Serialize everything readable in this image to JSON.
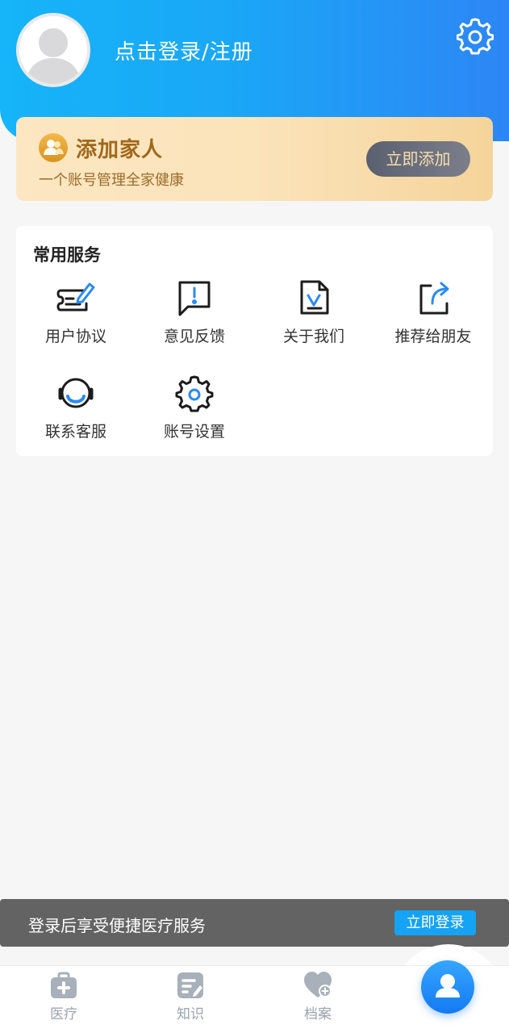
{
  "header": {
    "login_text": "点击登录/注册",
    "avatar_icon": "user-avatar-icon",
    "settings_icon": "gear-icon"
  },
  "family_card": {
    "title": "添加家人",
    "subtitle": "一个账号管理全家健康",
    "button_label": "立即添加",
    "icon": "family-icon"
  },
  "services": {
    "title": "常用服务",
    "items": [
      {
        "label": "用户协议",
        "icon": "agreement-icon"
      },
      {
        "label": "意见反馈",
        "icon": "feedback-icon"
      },
      {
        "label": "关于我们",
        "icon": "about-icon"
      },
      {
        "label": "推荐给朋友",
        "icon": "share-icon"
      },
      {
        "label": "联系客服",
        "icon": "headset-icon"
      },
      {
        "label": "账号设置",
        "icon": "gear-icon"
      }
    ]
  },
  "toast": {
    "text": "登录后享受便捷医疗服务",
    "button_label": "立即登录"
  },
  "tabbar": {
    "items": [
      {
        "label": "医疗",
        "icon": "medical-kit-icon"
      },
      {
        "label": "知识",
        "icon": "knowledge-icon"
      },
      {
        "label": "档案",
        "icon": "heart-record-icon"
      },
      {
        "label": "",
        "icon": "profile-icon"
      }
    ]
  },
  "colors": {
    "brand_blue": "#1aa7f7",
    "gold_text": "#a0681b",
    "tab_inactive": "#9aa3ad"
  }
}
